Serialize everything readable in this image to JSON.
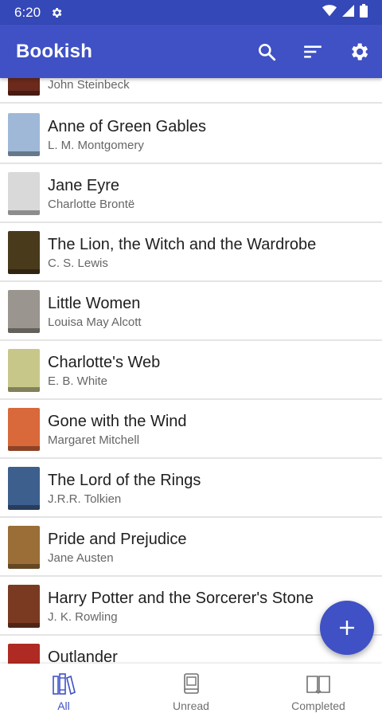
{
  "status_bar": {
    "time": "6:20"
  },
  "app_bar": {
    "title": "Bookish"
  },
  "books": [
    {
      "title": "",
      "author": "John Steinbeck",
      "cover_color": "#6b2a1c"
    },
    {
      "title": "Anne of Green Gables",
      "author": "L. M. Montgomery",
      "cover_color": "#9fb8d8"
    },
    {
      "title": "Jane Eyre",
      "author": "Charlotte Brontë",
      "cover_color": "#d9d9d9"
    },
    {
      "title": "The Lion, the Witch and the Wardrobe",
      "author": "C. S. Lewis",
      "cover_color": "#4a3a1c"
    },
    {
      "title": "Little Women",
      "author": "Louisa May Alcott",
      "cover_color": "#9a958e"
    },
    {
      "title": "Charlotte's Web",
      "author": "E. B. White",
      "cover_color": "#c8c78a"
    },
    {
      "title": "Gone with the Wind",
      "author": "Margaret Mitchell",
      "cover_color": "#d9683a"
    },
    {
      "title": "The Lord of the Rings",
      "author": "J.R.R. Tolkien",
      "cover_color": "#3c5f8e"
    },
    {
      "title": "Pride and Prejudice",
      "author": "Jane Austen",
      "cover_color": "#9a6e36"
    },
    {
      "title": "Harry Potter and the Sorcerer's Stone",
      "author": "J. K. Rowling",
      "cover_color": "#7a3a22"
    },
    {
      "title": "Outlander",
      "author": "",
      "cover_color": "#b02a24"
    }
  ],
  "bottom_nav": [
    {
      "label": "All",
      "active": true
    },
    {
      "label": "Unread",
      "active": false
    },
    {
      "label": "Completed",
      "active": false
    }
  ],
  "colors": {
    "primary": "#3f51c4",
    "status_bar": "#3548b8"
  }
}
